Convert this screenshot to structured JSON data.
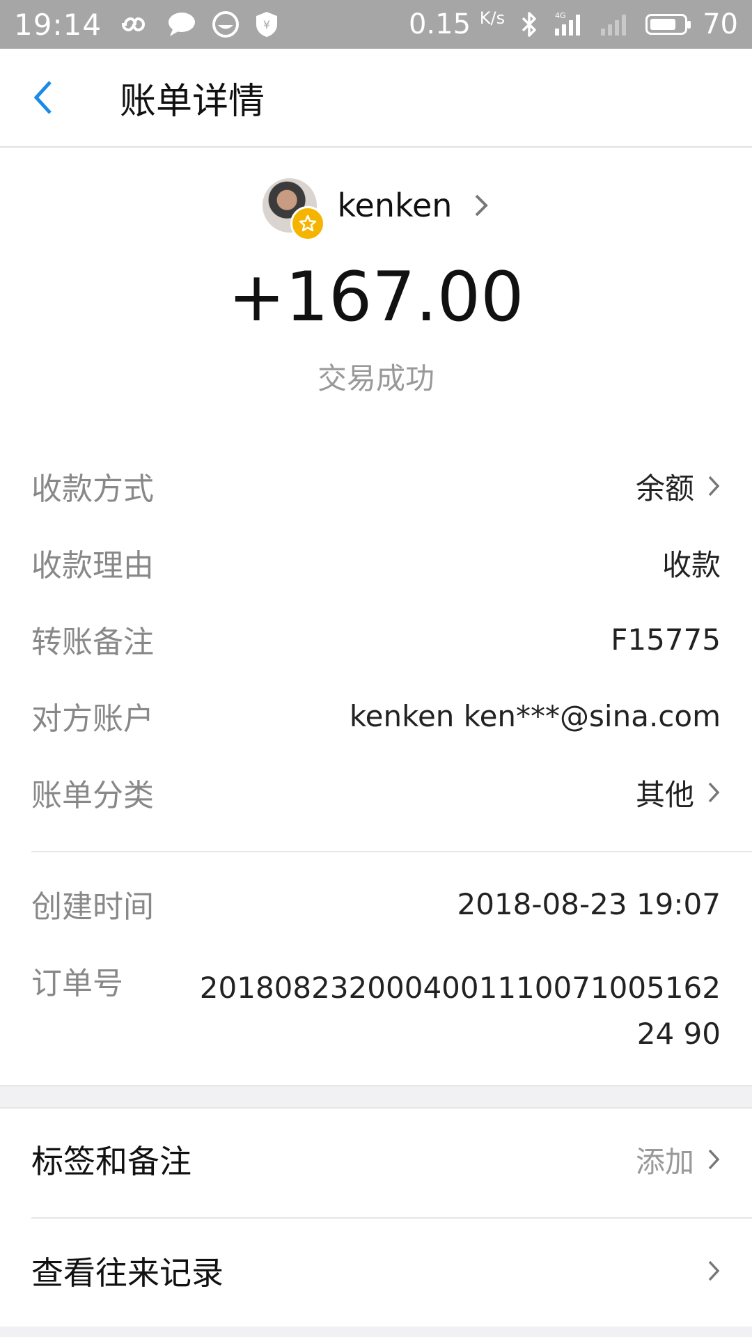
{
  "status_bar": {
    "time": "19:14",
    "speed": "0.15",
    "speed_unit": "K/s",
    "network": "4G",
    "battery": "70",
    "icons": [
      "infinity-icon",
      "chat-bubble-icon",
      "face-icon",
      "shield-yen-icon",
      "bluetooth-icon",
      "signal-icon",
      "signal-empty-icon",
      "battery-icon"
    ]
  },
  "header": {
    "title": "账单详情",
    "back_icon": "chevron-left-icon",
    "accent": "#1a8be6"
  },
  "profile": {
    "name": "kenken",
    "avatar_badge": "star-icon"
  },
  "transaction": {
    "amount": "+167.00",
    "status": "交易成功"
  },
  "details": [
    {
      "label": "收款方式",
      "value": "余额"
    },
    {
      "label": "收款理由",
      "value": "收款"
    },
    {
      "label": "转账备注",
      "value": "F15775"
    },
    {
      "label": "对方账户",
      "value": "kenken ken***@sina.com"
    },
    {
      "label": "账单分类",
      "value": "其他"
    }
  ],
  "meta": [
    {
      "label": "创建时间",
      "value": "2018-08-23 19:07"
    },
    {
      "label": "订单号",
      "value": "201808232000400111007100516224 90"
    }
  ],
  "actions": [
    {
      "label": "标签和备注",
      "value": "添加"
    },
    {
      "label": "查看往来记录",
      "value": ""
    }
  ]
}
